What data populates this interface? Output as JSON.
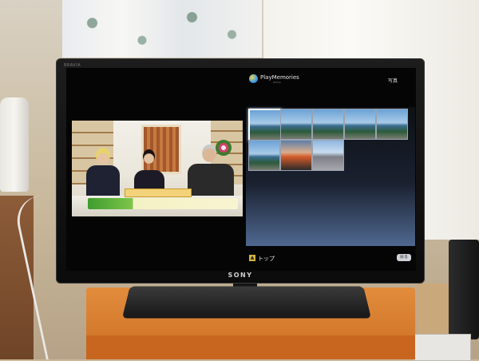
{
  "tv": {
    "brand_small": "BRAVIA",
    "logo": "SONY"
  },
  "playmemories": {
    "title": "PlayMemories",
    "subtitle": "Online",
    "section_label": "写真"
  },
  "photos": {
    "thumbnails": [
      {
        "name": "bridge-photo-1",
        "selected": true
      },
      {
        "name": "sea-photo-2",
        "selected": false
      },
      {
        "name": "sea-photo-3",
        "selected": false
      },
      {
        "name": "sea-photo-4",
        "selected": false
      },
      {
        "name": "bridge-photo-5",
        "selected": false
      },
      {
        "name": "bridge-photo-6",
        "selected": false
      },
      {
        "name": "sunset-photo-7",
        "selected": false
      },
      {
        "name": "road-photo-8",
        "selected": false
      }
    ]
  },
  "footer": {
    "top_label": "トップ",
    "back_label": "戻る"
  },
  "colors": {
    "panel_bottom": "#4f6890",
    "footer_icon": "#d3b33a"
  }
}
